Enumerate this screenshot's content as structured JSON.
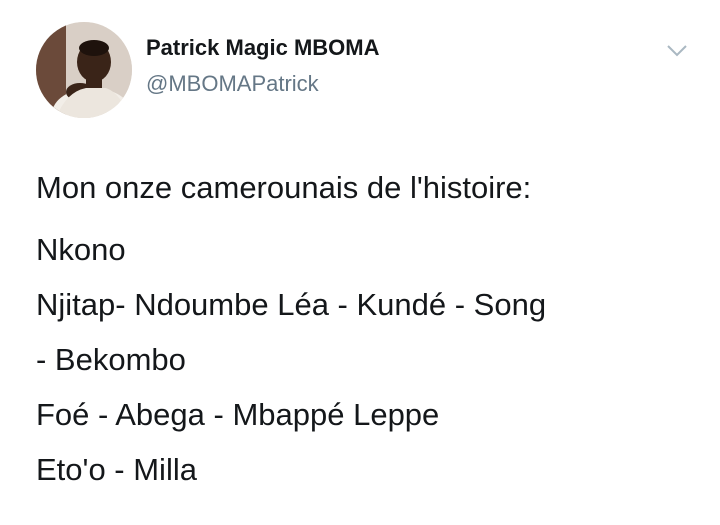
{
  "author": {
    "display_name": "Patrick Magic MBOMA",
    "handle": "@MBOMAPatrick"
  },
  "icons": {
    "avatar": "profile-photo",
    "menu": "chevron-down-icon"
  },
  "colors": {
    "text_primary": "#14171a",
    "text_secondary": "#657786",
    "caret": "#aab8c2"
  },
  "tweet": {
    "heading": "Mon onze camerounais de l'histoire:",
    "lines": [
      "Nkono",
      "Njitap- Ndoumbe Léa - Kundé - Song",
      "- Bekombo",
      "Foé - Abega - Mbappé Leppe",
      "Eto'o - Milla"
    ]
  }
}
